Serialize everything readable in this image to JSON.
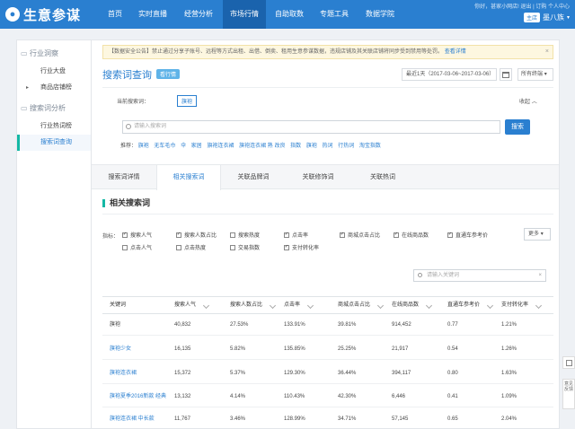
{
  "topnav": {
    "logo": "生意参谋",
    "items": [
      "首页",
      "实时直播",
      "经营分析",
      "市场行情",
      "自助取数",
      "专题工具",
      "数据学院"
    ],
    "active_index": 3,
    "right_text": "你好，甚家小网店!   退出   |   订购   个人中心",
    "shop_badge": "主店",
    "shop_name": "墨八族"
  },
  "sidebar": {
    "groups": [
      {
        "label": "行业洞察",
        "items": [
          "行业大盘",
          "商品店铺榜"
        ]
      },
      {
        "label": "搜索词分析",
        "items": [
          "行业热词榜",
          "搜索词查询"
        ]
      }
    ],
    "active_item": "搜索词查询"
  },
  "notice": {
    "text": "【数据安全公告】禁止通过分享子账号、远程等方式出租、出借、倒卖、租用生意参谋数据，违规店铺及其关联店铺将同步受到禁用等处罚。",
    "link": "查看详情",
    "close": "×"
  },
  "header": {
    "title": "搜索词查询",
    "tag": "看行情",
    "date_range": "最近1天（2017-03-06~2017-03-06）",
    "terminal": "所有终端"
  },
  "query": {
    "current_label": "当前搜索词：",
    "current_word": "旗袍",
    "collapse": "收起",
    "search_placeholder": "请输入搜索词",
    "search_button": "搜索",
    "recommend_label": "推荐：",
    "recommend_words": [
      "旗袍",
      "无车毛巾",
      "伞",
      "家居",
      "旗袍连衣裙",
      "旗袍连衣裙 熟 改良",
      "指数",
      "旗袍",
      "热词",
      "行热词",
      "淘宝指数"
    ]
  },
  "tabs": [
    "搜索词详情",
    "相关搜索词",
    "关联品牌词",
    "关联修饰词",
    "关联热词"
  ],
  "active_tab": 1,
  "section": {
    "title": "相关搜索词",
    "indicator_label": "指标：",
    "indicators": [
      {
        "label": "搜索人气",
        "checked": true
      },
      {
        "label": "搜索人数占比",
        "checked": true
      },
      {
        "label": "搜索热度",
        "checked": false
      },
      {
        "label": "点击率",
        "checked": true
      },
      {
        "label": "商城点击占比",
        "checked": true
      },
      {
        "label": "在线商品数",
        "checked": true
      },
      {
        "label": "直通车参考价",
        "checked": true
      },
      {
        "label": "点击人气",
        "checked": false
      },
      {
        "label": "点击热度",
        "checked": false
      },
      {
        "label": "交易指数",
        "checked": false
      },
      {
        "label": "支付转化率",
        "checked": true
      }
    ],
    "more": "更多",
    "filter_placeholder": "请输入关键词",
    "filter_clear": "×"
  },
  "table": {
    "columns": [
      "关键词",
      "搜索人气",
      "搜索人数占比",
      "点击率",
      "商城点击占比",
      "在线商品数",
      "直通车参考价",
      "支付转化率"
    ],
    "rows": [
      [
        "旗袍",
        "40,832",
        "27.53%",
        "133.91%",
        "39.81%",
        "914,452",
        "0.77",
        "1.21%"
      ],
      [
        "旗袍少女",
        "16,135",
        "5.82%",
        "135.85%",
        "25.25%",
        "21,917",
        "0.54",
        "1.26%"
      ],
      [
        "旗袍连衣裙",
        "15,372",
        "5.37%",
        "129.30%",
        "36.44%",
        "394,117",
        "0.80",
        "1.63%"
      ],
      [
        "旗袍夏季2016新款 经典",
        "13,132",
        "4.14%",
        "110.43%",
        "42.30%",
        "6,446",
        "0.41",
        "1.09%"
      ],
      [
        "旗袍连衣裙 中长款",
        "11,767",
        "3.46%",
        "128.99%",
        "34.71%",
        "57,145",
        "0.65",
        "2.04%"
      ]
    ]
  },
  "floating": {
    "feedback": "意见反馈"
  }
}
